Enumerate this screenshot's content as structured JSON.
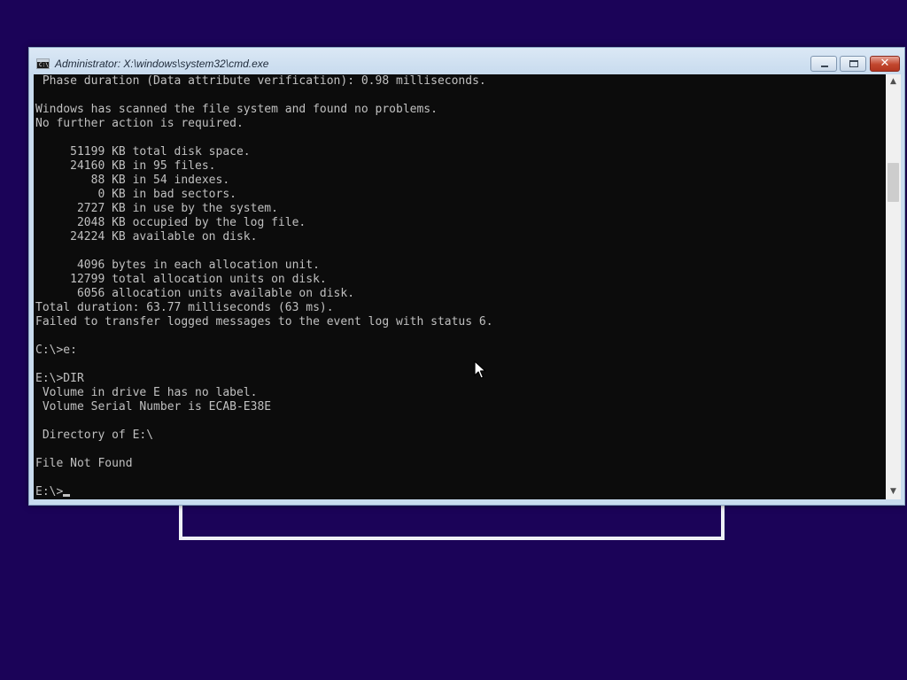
{
  "window": {
    "title": "Administrator: X:\\windows\\system32\\cmd.exe",
    "icon_text": "C:\\_",
    "close_glyph": "✕"
  },
  "console": {
    "lines": [
      " Phase duration (Data attribute verification): 0.98 milliseconds.",
      "",
      "Windows has scanned the file system and found no problems.",
      "No further action is required.",
      "",
      "     51199 KB total disk space.",
      "     24160 KB in 95 files.",
      "        88 KB in 54 indexes.",
      "         0 KB in bad sectors.",
      "      2727 KB in use by the system.",
      "      2048 KB occupied by the log file.",
      "     24224 KB available on disk.",
      "",
      "      4096 bytes in each allocation unit.",
      "     12799 total allocation units on disk.",
      "      6056 allocation units available on disk.",
      "Total duration: 63.77 milliseconds (63 ms).",
      "Failed to transfer logged messages to the event log with status 6.",
      "",
      "C:\\>e:",
      "",
      "E:\\>DIR",
      " Volume in drive E has no label.",
      " Volume Serial Number is ECAB-E38E",
      "",
      " Directory of E:\\",
      "",
      "File Not Found",
      ""
    ],
    "prompt": "E:\\>"
  },
  "colors": {
    "desktop": "#1b0358",
    "console_bg": "#0c0c0c",
    "console_text": "#c0c0c0",
    "close_button": "#c2472e"
  }
}
